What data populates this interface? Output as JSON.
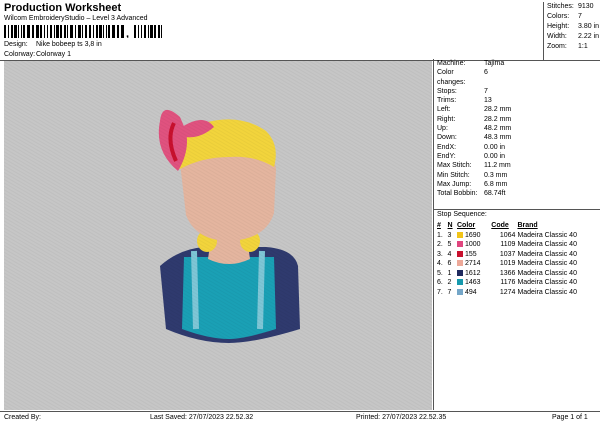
{
  "header": {
    "title": "Production Worksheet",
    "subtitle": "Wilcom EmbroideryStudio – Level 3 Advanced",
    "barcode_text": ",",
    "design_label": "Design:",
    "design_value": "Nike bobeep ts 3,8 in",
    "colorway_label": "Colorway:",
    "colorway_value": "Colorway 1"
  },
  "stats": [
    {
      "k": "Stitches:",
      "v": "9130"
    },
    {
      "k": "Colors:",
      "v": "7"
    },
    {
      "k": "Height:",
      "v": "3.80 in"
    },
    {
      "k": "Width:",
      "v": "2.22 in"
    },
    {
      "k": "Zoom:",
      "v": "1:1"
    }
  ],
  "machine_info": [
    {
      "k": "Machine:",
      "v": "Tajima"
    },
    {
      "k": "Color changes:",
      "v": "6"
    },
    {
      "k": "Stops:",
      "v": "7"
    },
    {
      "k": "Trims:",
      "v": "13"
    },
    {
      "k": "Left:",
      "v": "28.2 mm"
    },
    {
      "k": "Right:",
      "v": "28.2 mm"
    },
    {
      "k": "Up:",
      "v": "48.2 mm"
    },
    {
      "k": "Down:",
      "v": "48.3 mm"
    },
    {
      "k": "EndX:",
      "v": "0.00 in"
    },
    {
      "k": "EndY:",
      "v": "0.00 in"
    },
    {
      "k": "Max Stitch:",
      "v": "11.2 mm"
    },
    {
      "k": "Min Stitch:",
      "v": "0.3 mm"
    },
    {
      "k": "Max Jump:",
      "v": "6.8 mm"
    },
    {
      "k": "Total Bobbin:",
      "v": "68.74ft"
    }
  ],
  "stop_sequence": {
    "title": "Stop Sequence:",
    "headers": [
      "#",
      "N",
      "Color",
      "Code",
      "Brand"
    ],
    "rows": [
      {
        "num": "1.",
        "n": "3",
        "color": "1690",
        "code": "1064",
        "brand": "Madeira Classic 40",
        "hex": "#f2c418"
      },
      {
        "num": "2.",
        "n": "5",
        "color": "1000",
        "code": "1109",
        "brand": "Madeira Classic 40",
        "hex": "#e0457e"
      },
      {
        "num": "3.",
        "n": "4",
        "color": "155",
        "code": "1037",
        "brand": "Madeira Classic 40",
        "hex": "#c8102e"
      },
      {
        "num": "4.",
        "n": "6",
        "color": "2714",
        "code": "1019",
        "brand": "Madeira Classic 40",
        "hex": "#eda898"
      },
      {
        "num": "5.",
        "n": "1",
        "color": "1612",
        "code": "1366",
        "brand": "Madeira Classic 40",
        "hex": "#1f2a5e"
      },
      {
        "num": "6.",
        "n": "2",
        "color": "1463",
        "code": "1176",
        "brand": "Madeira Classic 40",
        "hex": "#1699ad"
      },
      {
        "num": "7.",
        "n": "7",
        "color": "494",
        "code": "1274",
        "brand": "Madeira Classic 40",
        "hex": "#74a6c8"
      }
    ]
  },
  "footer": {
    "created_by": "Created By:",
    "last_saved": "Last Saved: 27/07/2023 22.52.32",
    "printed": "Printed: 27/07/2023 22.52.35",
    "page": "Page 1 of 1"
  },
  "colors": {
    "canvas_bg": "#c6c6c6",
    "hair": "#f2d43c",
    "bow": "#e0527f",
    "bow_dark": "#c8102e",
    "skin": "#e4b59f",
    "jacket": "#2f3a6e",
    "dress": "#1aa0b5",
    "trim": "#7ec6d6"
  }
}
